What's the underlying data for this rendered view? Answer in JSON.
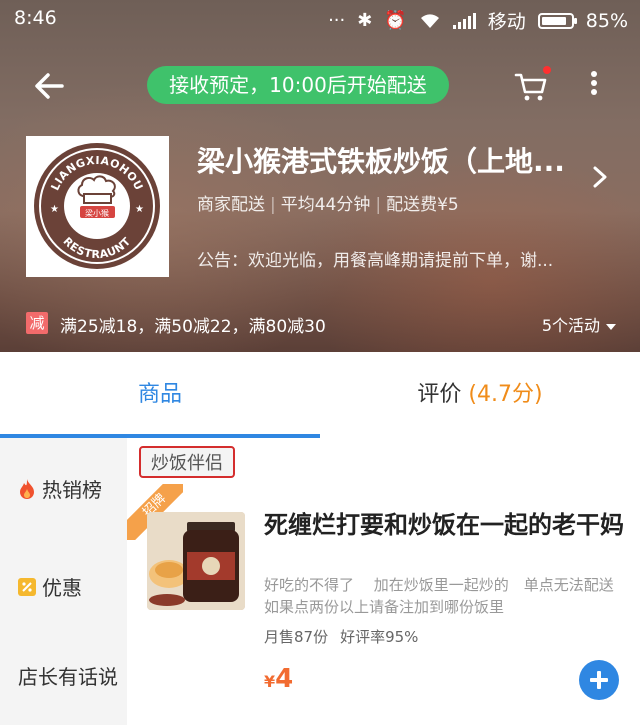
{
  "status_bar": {
    "time": "8:46",
    "carrier": "移动",
    "battery": "85%",
    "battery_level": 0.85
  },
  "header": {
    "notice": "接收预定，10:00后开始配送",
    "cart_has_badge": true,
    "logo": {
      "text_top": "LIANGXIAOHOU",
      "text_bottom": "RESTRAUNT",
      "text_center": "梁小猴"
    },
    "store_name": "梁小猴港式铁板炒饭（上地...",
    "meta": {
      "delivery": "商家配送",
      "avg_time": "平均44分钟",
      "fee": "配送费¥5"
    },
    "announcement": "公告：欢迎光临，用餐高峰期请提前下单，谢...",
    "promo_badge": "减",
    "promo_text": "满25减18，满50减22，满80减30",
    "activity_count": "5个活动"
  },
  "tabs": {
    "goods": "商品",
    "reviews": "评价",
    "reviews_score": "(4.7分)"
  },
  "sidebar": {
    "items": [
      {
        "label": "热销榜",
        "icon": "flame-icon"
      },
      {
        "label": "优惠",
        "icon": "discount-icon"
      },
      {
        "label": "店长有话说",
        "icon": ""
      }
    ]
  },
  "main": {
    "section_title": "炒饭伴侣",
    "item": {
      "ribbon": "招牌",
      "name": "死缠烂打要和炒饭在一起的老干妈",
      "desc": "好吃的不得了　 加在炒饭里一起炒的　单点无法配送　如果点两份以上请备注加到哪份饭里",
      "monthly_sales": "月售87份",
      "rating": "好评率95%",
      "currency": "¥",
      "price": "4"
    }
  },
  "colors": {
    "accent_blue": "#2f87e2",
    "notice_green": "#3fc26b",
    "promo_red": "#f26b6b",
    "price_orange": "#f26b30",
    "score_orange": "#f08c1a",
    "highlight_red": "#d42d2d"
  }
}
